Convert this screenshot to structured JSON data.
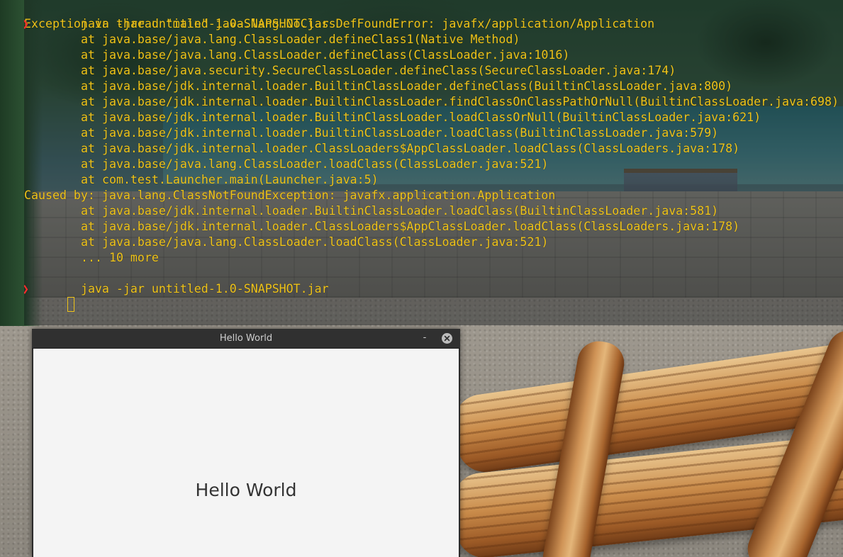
{
  "colors": {
    "terminal_text": "#f0c419",
    "prompt_arrow": "#ff2d2d",
    "window_titlebar": "#303030",
    "window_content": "#f4f4f4",
    "label_text": "#333333"
  },
  "terminal": {
    "prompt_symbol": "❯",
    "command_1": "java -jar untitled-1.0-SNAPSHOT.jar",
    "lines": [
      "Exception in thread \"main\" java.lang.NoClassDefFoundError: javafx/application/Application",
      "at java.base/java.lang.ClassLoader.defineClass1(Native Method)",
      "at java.base/java.lang.ClassLoader.defineClass(ClassLoader.java:1016)",
      "at java.base/java.security.SecureClassLoader.defineClass(SecureClassLoader.java:174)",
      "at java.base/jdk.internal.loader.BuiltinClassLoader.defineClass(BuiltinClassLoader.java:800)",
      "at java.base/jdk.internal.loader.BuiltinClassLoader.findClassOnClassPathOrNull(BuiltinClassLoader.java:698)",
      "at java.base/jdk.internal.loader.BuiltinClassLoader.loadClassOrNull(BuiltinClassLoader.java:621)",
      "at java.base/jdk.internal.loader.BuiltinClassLoader.loadClass(BuiltinClassLoader.java:579)",
      "at java.base/jdk.internal.loader.ClassLoaders$AppClassLoader.loadClass(ClassLoaders.java:178)",
      "at java.base/java.lang.ClassLoader.loadClass(ClassLoader.java:521)",
      "at com.test.Launcher.main(Launcher.java:5)",
      "Caused by: java.lang.ClassNotFoundException: javafx.application.Application",
      "at java.base/jdk.internal.loader.BuiltinClassLoader.loadClass(BuiltinClassLoader.java:581)",
      "at java.base/jdk.internal.loader.ClassLoaders$AppClassLoader.loadClass(ClassLoaders.java:178)",
      "at java.base/java.lang.ClassLoader.loadClass(ClassLoader.java:521)",
      "... 10 more"
    ],
    "command_2": "java -jar untitled-1.0-SNAPSHOT.jar"
  },
  "window": {
    "title": "Hello World",
    "minimize_glyph": "-",
    "close_icon": "close-icon",
    "label": "Hello World"
  }
}
